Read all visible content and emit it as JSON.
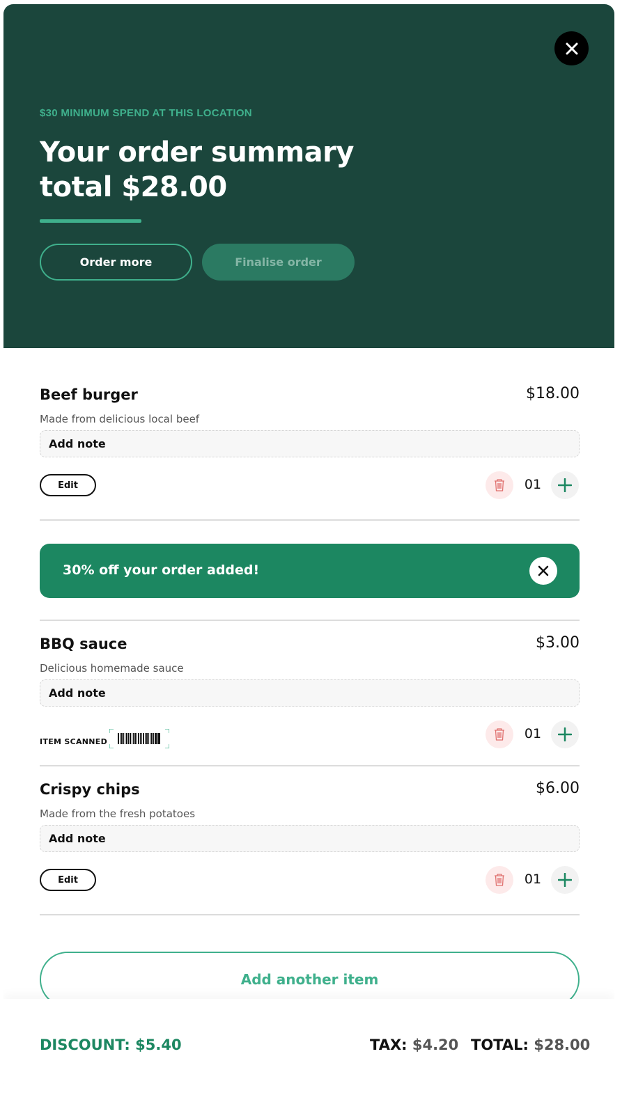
{
  "header": {
    "min_spend": "$30 MINIMUM SPEND AT THIS LOCATION",
    "title_line1": "Your order summary",
    "title_line2": "total $28.00",
    "order_more_label": "Order more",
    "finalise_label": "Finalise order"
  },
  "items": [
    {
      "name": "Beef burger",
      "price": "$18.00",
      "description": "Made from delicious local beef",
      "note_label": "Add note",
      "edit_label": "Edit",
      "quantity": "01"
    },
    {
      "name": "BBQ sauce",
      "price": "$3.00",
      "description": "Delicious homemade sauce",
      "note_label": "Add note",
      "scanned_label": "ITEM SCANNED",
      "quantity": "01"
    },
    {
      "name": "Crispy chips",
      "price": "$6.00",
      "description": "Made from the fresh potatoes",
      "note_label": "Add note",
      "edit_label": "Edit",
      "quantity": "01"
    }
  ],
  "promo": {
    "text": "30% off your order added!"
  },
  "add_another_label": "Add another item",
  "footer": {
    "discount_label": "DISCOUNT:",
    "discount_value": "$5.40",
    "tax_label": "TAX:",
    "tax_value": "$4.20",
    "total_label": "TOTAL:",
    "total_value": "$28.00"
  },
  "icons": {
    "close": "close-icon",
    "trash": "trash-icon",
    "plus": "plus-icon",
    "barcode": "barcode-icon"
  },
  "colors": {
    "hero_bg": "#1b463c",
    "accent": "#3fb08c",
    "promo_bg": "#1c8761",
    "trash_bg": "#fdeaea",
    "trash_icon": "#e0706e"
  }
}
